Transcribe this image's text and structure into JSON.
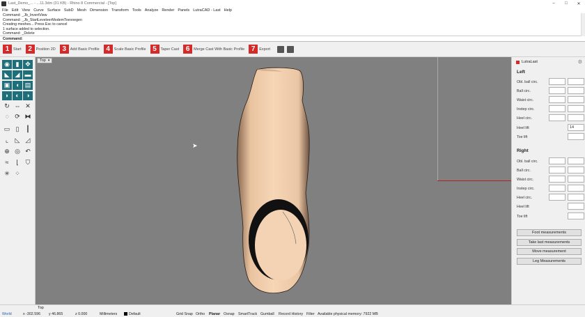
{
  "titlebar": {
    "title": "Last_Demo_... - ...11.3dm (31 KB) - Rhino 8 Commercial - [Top]"
  },
  "menu": [
    "File",
    "Edit",
    "View",
    "Curve",
    "Surface",
    "SubD",
    "Mesh",
    "Dimension",
    "Transform",
    "Tools",
    "Analyze",
    "Render",
    "Panels",
    "LutraCAD - Last",
    "Help"
  ],
  "command_history": [
    "Command: _Jb_InvertView",
    "Command: _Jb_StartLeveleerModemToevoegen",
    "Creating meshes... Press Esc to cancel",
    "1 surface added to selection.",
    "Command: _Delete"
  ],
  "command_prompt": "Command:",
  "steps": [
    {
      "num": "1",
      "label": "Start"
    },
    {
      "num": "2",
      "label": "Position 2D"
    },
    {
      "num": "3",
      "label": "Add Basic Profile"
    },
    {
      "num": "4",
      "label": "Scale Basic Profile"
    },
    {
      "num": "5",
      "label": "Taper Cast"
    },
    {
      "num": "6",
      "label": "Merge Cast With Basic Profile"
    },
    {
      "num": "7",
      "label": "Export"
    }
  ],
  "viewport": {
    "label": "Top"
  },
  "panel": {
    "title": "LutraLast",
    "left": {
      "title": "Left",
      "rows": [
        "Obl. ball circ.",
        "Ball circ.",
        "Waist circ.",
        "Instep circ.",
        "Heel circ.",
        "Heel lift",
        "Toe lift"
      ],
      "heel_lift_value": "14"
    },
    "right": {
      "title": "Right",
      "rows": [
        "Obl. ball circ.",
        "Ball circ.",
        "Waist circ.",
        "Instep circ.",
        "Heel circ.",
        "Heel lift",
        "Toe lift"
      ]
    },
    "buttons": [
      "Foot measurements",
      "Take last measurements",
      "Move measurement",
      "Leg Measurements"
    ]
  },
  "statusbar": {
    "tab": "Top",
    "cplane": "World",
    "x": "x -302.596",
    "y": "y 46.865",
    "z": "z 0.000",
    "units": "Millimeters",
    "layer": "Default",
    "toggles": [
      "Grid Snap",
      "Ortho",
      "Planar",
      "Osnap",
      "SmartTrack",
      "Gumball",
      "Record History",
      "Filter"
    ],
    "memory": "Available physical memory: 7922 MB"
  },
  "colors": {
    "accent": "#d42a2a",
    "tool_teal": "#1f6f7a",
    "viewport_bg": "#808080",
    "foot_skin": "#f3d0ad"
  }
}
